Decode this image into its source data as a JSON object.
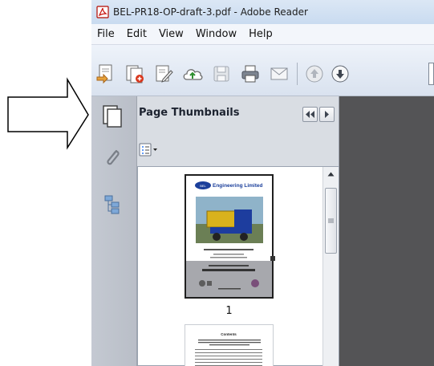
{
  "window": {
    "title": "BEL-PR18-OP-draft-3.pdf - Adobe Reader"
  },
  "menu": [
    "File",
    "Edit",
    "View",
    "Window",
    "Help"
  ],
  "toolbar": {
    "buttons": [
      "create-pdf-icon",
      "combine-files-icon",
      "edit-document-icon",
      "upload-cloud-icon",
      "save-icon",
      "print-icon",
      "email-icon",
      "previous-page-icon",
      "next-page-icon"
    ]
  },
  "panel": {
    "title": "Page Thumbnails",
    "collapse_icon": "double-chevron-left-icon",
    "expand_icon": "triangle-right-icon",
    "options_icon": "thumbnail-options-icon"
  },
  "thumbnails": [
    {
      "page_label": "1",
      "header_text": "Engineering Limited",
      "selected": true
    },
    {
      "page_label": "",
      "header_text": "Contents",
      "selected": false
    }
  ],
  "colors": {
    "document_background": "#545456",
    "panel_background": "#d9dde3",
    "nav_rail": "#bfc4cd",
    "title_bar": "#d4e3f4",
    "selection_border": "#1f1f1f"
  }
}
